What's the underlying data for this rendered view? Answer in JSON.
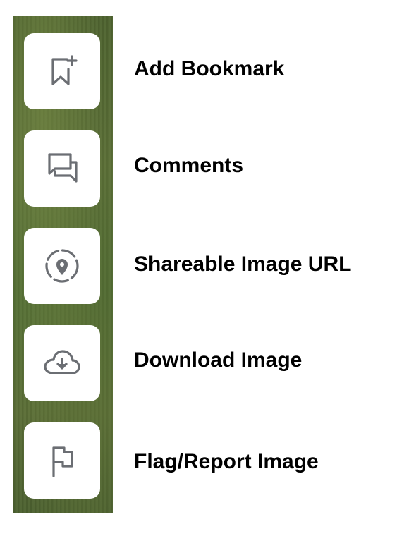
{
  "actions": [
    {
      "label": "Add Bookmark",
      "icon": "bookmark-add-icon"
    },
    {
      "label": "Comments",
      "icon": "comments-icon"
    },
    {
      "label": "Shareable Image URL",
      "icon": "location-pin-icon"
    },
    {
      "label": "Download Image",
      "icon": "cloud-download-icon"
    },
    {
      "label": "Flag/Report Image",
      "icon": "flag-icon"
    }
  ],
  "colors": {
    "icon": "#6b6e73",
    "sidebar_bg": "#54693a",
    "button_bg": "#ffffff",
    "label_text": "#000000"
  }
}
